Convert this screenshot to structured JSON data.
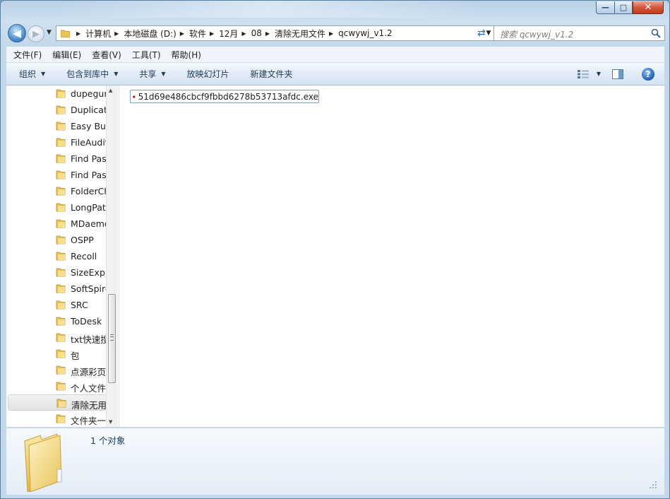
{
  "window": {
    "caption": {
      "minimize": "—",
      "maximize": "□",
      "close": "✕"
    }
  },
  "nav": {
    "back_glyph": "◀",
    "forward_glyph": "▶",
    "history_glyph": "▼",
    "refresh_glyph": "⇄"
  },
  "address": {
    "crumbs": [
      "计算机",
      "本地磁盘 (D:)",
      "软件",
      "12月",
      "08",
      "清除无用文件",
      "qcwywj_v1.2"
    ],
    "dropdown_glyph": "▼"
  },
  "search": {
    "placeholder": "搜索 qcwywj_v1.2"
  },
  "menubar": {
    "items": [
      "文件(F)",
      "编辑(E)",
      "查看(V)",
      "工具(T)",
      "帮助(H)"
    ]
  },
  "commandbar": {
    "organize": "组织",
    "include_in_library": "包含到库中",
    "share": "共享",
    "slideshow": "放映幻灯片",
    "new_folder": "新建文件夹",
    "dropdown_glyph": "▼",
    "help_glyph": "?"
  },
  "navpane": {
    "items": [
      "dupegur",
      "Duplicate",
      "Easy But",
      "FileAudit",
      "Find Pass",
      "Find Pass",
      "FolderCh",
      "LongPath",
      "MDaemo",
      "OSPP",
      "Recoll",
      "SizeExplo",
      "SoftSpire",
      "SRC",
      "ToDesk",
      "txt快速搜",
      "包",
      "点源彩页",
      "个人文件",
      "清除无用",
      "文件夹一"
    ],
    "selected_index": 19,
    "scroll_up_glyph": "▲",
    "scroll_down_glyph": "▼"
  },
  "content": {
    "files": [
      {
        "name": "51d69e486cbcf9fbbd6278b53713afdc.exe",
        "icon": "exe-icon"
      }
    ]
  },
  "details": {
    "count_text": "1 个对象"
  },
  "colors": {
    "accent": "#2c6fb0",
    "selection_border": "#7aa3cf",
    "chrome": "#c3d8ea"
  }
}
